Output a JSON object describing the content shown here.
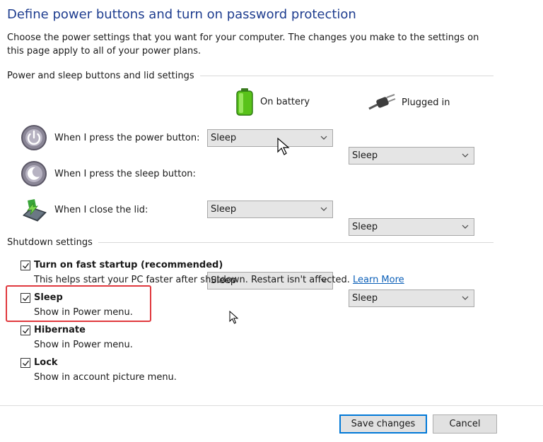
{
  "page": {
    "title": "Define power buttons and turn on password protection",
    "description": "Choose the power settings that you want for your computer. The changes you make to the settings on this page apply to all of your power plans."
  },
  "buttons_section": {
    "heading": "Power and sleep buttons and lid settings",
    "columns": {
      "battery": "On battery",
      "plugged": "Plugged in"
    },
    "rows": [
      {
        "label": "When I press the power button:",
        "battery": "Sleep",
        "plugged": "Sleep",
        "icon": "power-button-icon"
      },
      {
        "label": "When I press the sleep button:",
        "battery": "Sleep",
        "plugged": "Sleep",
        "icon": "sleep-button-icon"
      },
      {
        "label": "When I close the lid:",
        "battery": "Sleep",
        "plugged": "Sleep",
        "icon": "laptop-lid-icon"
      }
    ]
  },
  "shutdown": {
    "heading": "Shutdown settings",
    "items": [
      {
        "label": "Turn on fast startup (recommended)",
        "desc": "This helps start your PC faster after shutdown. Restart isn't affected.",
        "link": "Learn More",
        "checked": true
      },
      {
        "label": "Sleep",
        "desc": "Show in Power menu.",
        "checked": true
      },
      {
        "label": "Hibernate",
        "desc": "Show in Power menu.",
        "checked": true
      },
      {
        "label": "Lock",
        "desc": "Show in account picture menu.",
        "checked": true
      }
    ]
  },
  "footer": {
    "save": "Save changes",
    "cancel": "Cancel"
  },
  "colors": {
    "title": "#1e3d8f",
    "link": "#0b5fb8",
    "highlight": "#e0393e",
    "accent": "#0078d7"
  }
}
